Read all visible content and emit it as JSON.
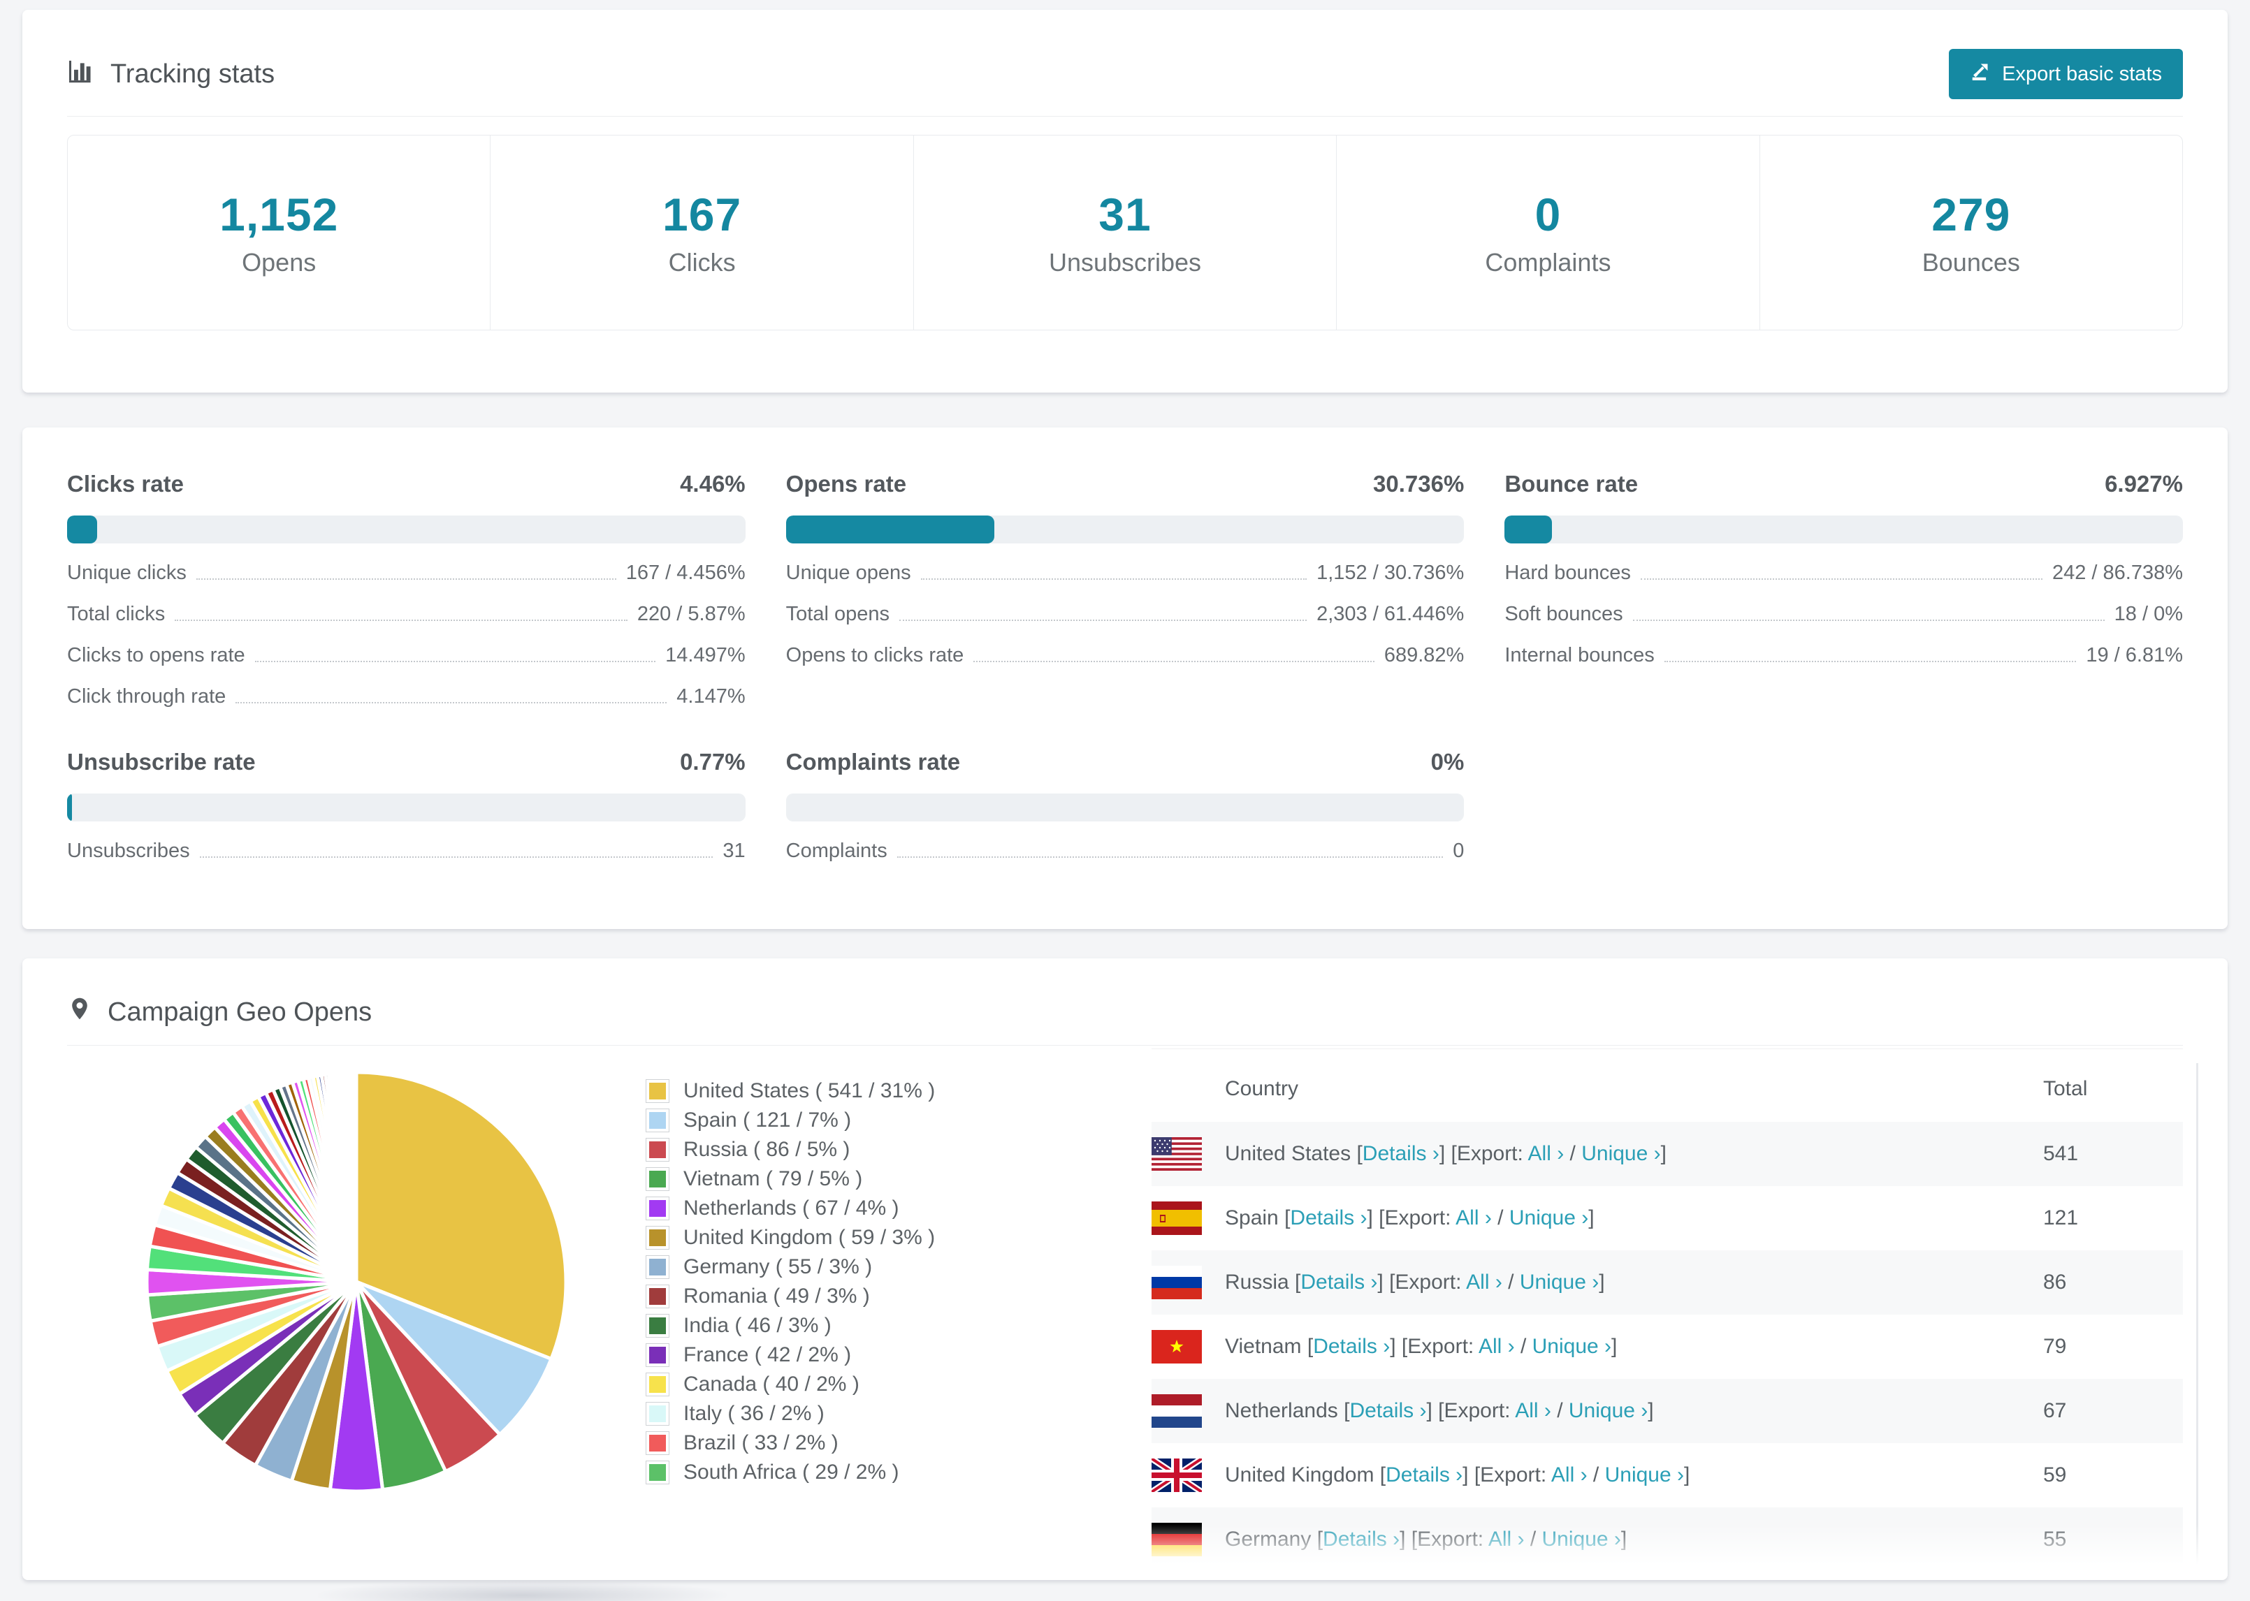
{
  "accent": "#1589a2",
  "link_color": "#2b9fb6",
  "page_bg": "#f4f5f7",
  "tracking": {
    "title": "Tracking stats",
    "export_label": "Export basic stats",
    "stats": [
      {
        "value": "1,152",
        "label": "Opens"
      },
      {
        "value": "167",
        "label": "Clicks"
      },
      {
        "value": "31",
        "label": "Unsubscribes"
      },
      {
        "value": "0",
        "label": "Complaints"
      },
      {
        "value": "279",
        "label": "Bounces"
      }
    ]
  },
  "rates": {
    "blocks": [
      {
        "title": "Clicks rate",
        "value": "4.46%",
        "pct": 4.46,
        "rows": [
          {
            "label": "Unique clicks",
            "value": "167 / 4.456%"
          },
          {
            "label": "Total clicks",
            "value": "220 / 5.87%"
          },
          {
            "label": "Clicks to opens rate",
            "value": "14.497%"
          },
          {
            "label": "Click through rate",
            "value": "4.147%"
          }
        ]
      },
      {
        "title": "Opens rate",
        "value": "30.736%",
        "pct": 30.736,
        "rows": [
          {
            "label": "Unique opens",
            "value": "1,152 / 30.736%"
          },
          {
            "label": "Total opens",
            "value": "2,303 / 61.446%"
          },
          {
            "label": "Opens to clicks rate",
            "value": "689.82%"
          }
        ]
      },
      {
        "title": "Bounce rate",
        "value": "6.927%",
        "pct": 6.927,
        "rows": [
          {
            "label": "Hard bounces",
            "value": "242 / 86.738%"
          },
          {
            "label": "Soft bounces",
            "value": "18 / 0%"
          },
          {
            "label": "Internal bounces",
            "value": "19 / 6.81%"
          }
        ]
      },
      {
        "title": "Unsubscribe rate",
        "value": "0.77%",
        "pct": 0.77,
        "rows": [
          {
            "label": "Unsubscribes",
            "value": "31"
          }
        ]
      },
      {
        "title": "Complaints rate",
        "value": "0%",
        "pct": 0,
        "rows": [
          {
            "label": "Complaints",
            "value": "0"
          }
        ]
      }
    ]
  },
  "geo": {
    "title": "Campaign Geo Opens",
    "link_labels": {
      "details": "Details",
      "export": "Export:",
      "all": "All",
      "unique": "Unique",
      "chevron": "›"
    },
    "table": {
      "headers": [
        "Country",
        "Total"
      ],
      "rows": [
        {
          "country": "United States",
          "flag": "us",
          "total": "541"
        },
        {
          "country": "Spain",
          "flag": "es",
          "total": "121"
        },
        {
          "country": "Russia",
          "flag": "ru",
          "total": "86"
        },
        {
          "country": "Vietnam",
          "flag": "vn",
          "total": "79"
        },
        {
          "country": "Netherlands",
          "flag": "nl",
          "total": "67"
        },
        {
          "country": "United Kingdom",
          "flag": "gb",
          "total": "59"
        },
        {
          "country": "Germany",
          "flag": "de",
          "total": "55"
        }
      ]
    }
  },
  "chart_data": {
    "type": "pie",
    "title": "Campaign Geo Opens",
    "legend_position": "right",
    "slices": [
      {
        "name": "United States",
        "opens": 541,
        "pct": 31,
        "color": "#e8c344"
      },
      {
        "name": "Spain",
        "opens": 121,
        "pct": 7,
        "color": "#aed5f2"
      },
      {
        "name": "Russia",
        "opens": 86,
        "pct": 5,
        "color": "#cb4a50"
      },
      {
        "name": "Vietnam",
        "opens": 79,
        "pct": 5,
        "color": "#4aa951"
      },
      {
        "name": "Netherlands",
        "opens": 67,
        "pct": 4,
        "color": "#a23af2"
      },
      {
        "name": "United Kingdom",
        "opens": 59,
        "pct": 3,
        "color": "#b8922b"
      },
      {
        "name": "Germany",
        "opens": 55,
        "pct": 3,
        "color": "#8fb1d1"
      },
      {
        "name": "Romania",
        "opens": 49,
        "pct": 3,
        "color": "#a03c3c"
      },
      {
        "name": "India",
        "opens": 46,
        "pct": 3,
        "color": "#3a7d41"
      },
      {
        "name": "France",
        "opens": 42,
        "pct": 2,
        "color": "#7a2fb8"
      },
      {
        "name": "Canada",
        "opens": 40,
        "pct": 2,
        "color": "#f7e24c"
      },
      {
        "name": "Italy",
        "opens": 36,
        "pct": 2,
        "color": "#d9f8f8"
      },
      {
        "name": "Brazil",
        "opens": 33,
        "pct": 2,
        "color": "#f15b5b"
      },
      {
        "name": "South Africa",
        "opens": 29,
        "pct": 2,
        "color": "#5cc168"
      }
    ],
    "others_unlabeled": {
      "total_pct": 26,
      "count": 40,
      "decay": 0.93,
      "colors": [
        "#e052f0",
        "#52e07a",
        "#f05252",
        "#f4fbfd",
        "#f5e050",
        "#2a3f8f",
        "#7a2020",
        "#1f5c2d",
        "#5a7388",
        "#9a7d1f",
        "#d946ef",
        "#39c160",
        "#f87171",
        "#dff3fb",
        "#f7e14a",
        "#6d28d9",
        "#b91c1c",
        "#14532d",
        "#64748b",
        "#a16207"
      ]
    }
  }
}
